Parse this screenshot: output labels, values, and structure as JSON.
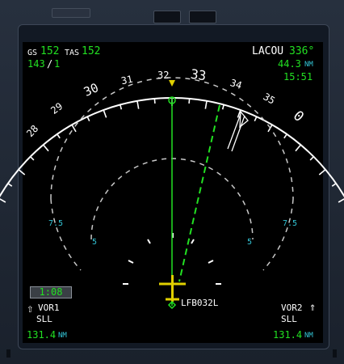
{
  "display": {
    "gs_label": "GS",
    "gs_value": "152",
    "tas_label": "TAS",
    "tas_value": "152",
    "wind_dir": "143",
    "wind_sep": "/",
    "wind_speed": "1",
    "waypoint_name": "LACOU",
    "waypoint_bearing": "336°",
    "waypoint_distance": "44.3",
    "waypoint_distance_unit": "NM",
    "waypoint_eta": "15:51",
    "chrono": "1:08",
    "compass_labels": [
      "28",
      "29",
      "30",
      "31",
      "32",
      "33",
      "34",
      "35",
      "0"
    ],
    "range_outer_left": "7.5",
    "range_outer_right": "7.5",
    "range_inner_left": "5",
    "range_inner_right": "5",
    "fix_label": "LFB032L",
    "vor1": {
      "label": "VOR1",
      "ident": "SLL",
      "distance": "131.4",
      "unit": "NM"
    },
    "vor2": {
      "label": "VOR2",
      "ident": "SLL",
      "distance": "131.4",
      "unit": "NM"
    },
    "colors": {
      "text": "#ffffff",
      "green": "#22e022",
      "cyan": "#33c5d6",
      "yellow": "#e0d000",
      "background": "#000000"
    }
  }
}
